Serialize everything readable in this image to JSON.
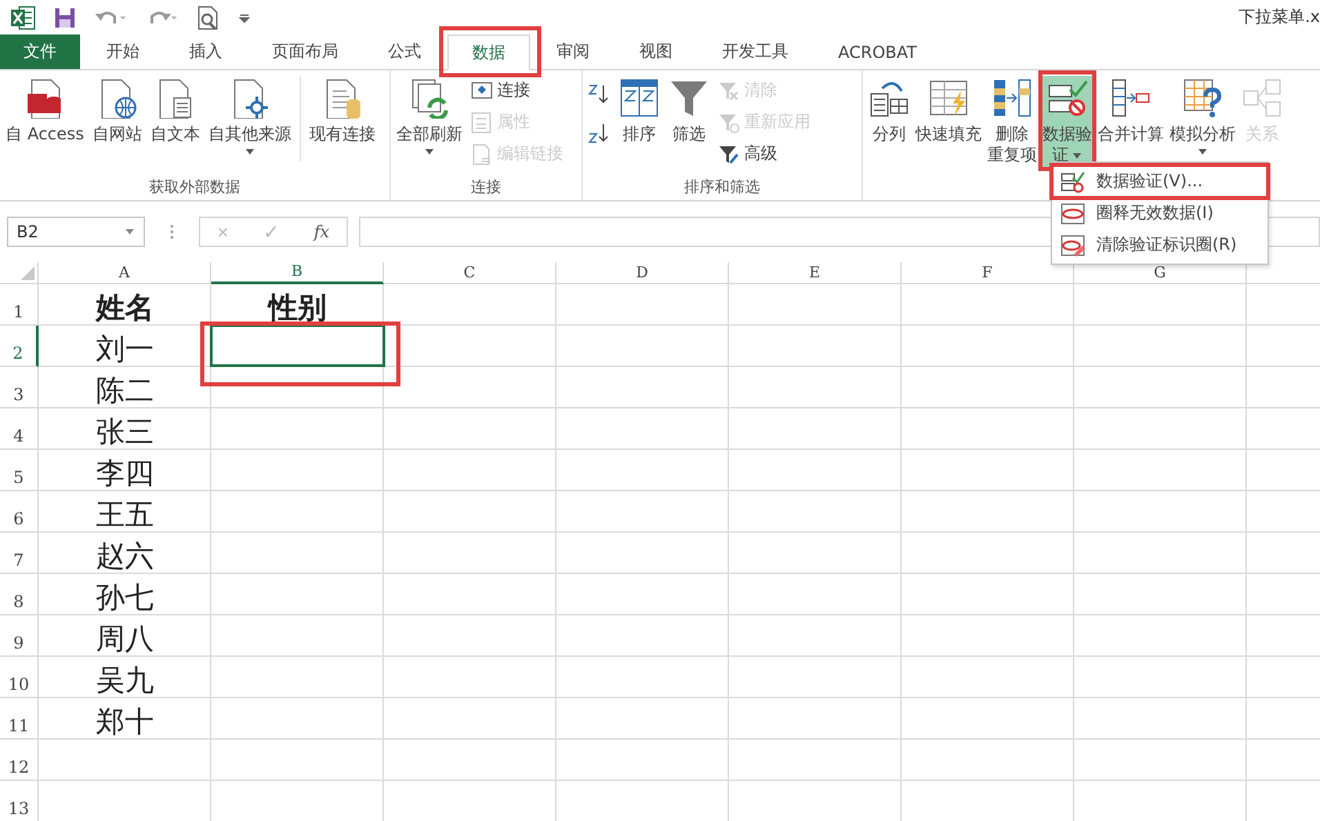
{
  "title": "下拉菜单.x",
  "tabs": [
    {
      "label": "文件",
      "kind": "file",
      "selected": false,
      "annotated": false
    },
    {
      "label": "开始",
      "kind": "tab",
      "selected": false,
      "annotated": false
    },
    {
      "label": "插入",
      "kind": "tab",
      "selected": false,
      "annotated": false
    },
    {
      "label": "页面布局",
      "kind": "tab",
      "selected": false,
      "annotated": false
    },
    {
      "label": "公式",
      "kind": "tab",
      "selected": false,
      "annotated": false
    },
    {
      "label": "数据",
      "kind": "tab",
      "selected": true,
      "annotated": true
    },
    {
      "label": "审阅",
      "kind": "tab",
      "selected": false,
      "annotated": false
    },
    {
      "label": "视图",
      "kind": "tab",
      "selected": false,
      "annotated": false
    },
    {
      "label": "开发工具",
      "kind": "tab",
      "selected": false,
      "annotated": false
    },
    {
      "label": "ACROBAT",
      "kind": "tab",
      "selected": false,
      "annotated": false
    }
  ],
  "ribbon": {
    "groups": [
      {
        "label": "获取外部数据",
        "buttons": [
          {
            "kind": "large",
            "lines": [
              "自 Access"
            ],
            "disabled": false,
            "dropdown": false
          },
          {
            "kind": "large",
            "lines": [
              "自网站"
            ],
            "disabled": false,
            "dropdown": false
          },
          {
            "kind": "large",
            "lines": [
              "自文本"
            ],
            "disabled": false,
            "dropdown": false
          },
          {
            "kind": "large",
            "lines": [
              "自其他来源"
            ],
            "disabled": false,
            "dropdown": true
          },
          {
            "kind": "large",
            "lines": [
              "现有连接"
            ],
            "disabled": false,
            "dropdown": false
          }
        ]
      },
      {
        "label": "连接",
        "buttons": [
          {
            "kind": "large",
            "lines": [
              "全部刷新"
            ],
            "disabled": false,
            "dropdown": true
          },
          {
            "kind": "small",
            "lines": [
              "连接"
            ],
            "disabled": false
          },
          {
            "kind": "small",
            "lines": [
              "属性"
            ],
            "disabled": true
          },
          {
            "kind": "small",
            "lines": [
              "编辑链接"
            ],
            "disabled": true
          }
        ]
      },
      {
        "label": "排序和筛选",
        "buttons": [
          {
            "kind": "icon"
          },
          {
            "kind": "icon"
          },
          {
            "kind": "large",
            "lines": [
              "排序"
            ],
            "disabled": false,
            "dropdown": false
          },
          {
            "kind": "large",
            "lines": [
              "筛选"
            ],
            "disabled": false,
            "dropdown": false
          },
          {
            "kind": "small",
            "lines": [
              "清除"
            ],
            "disabled": true
          },
          {
            "kind": "small",
            "lines": [
              "重新应用"
            ],
            "disabled": true
          },
          {
            "kind": "small",
            "lines": [
              "高级"
            ],
            "disabled": false
          }
        ]
      },
      {
        "buttons": [
          {
            "kind": "large",
            "lines": [
              "分列"
            ],
            "disabled": false,
            "dropdown": false
          },
          {
            "kind": "large",
            "lines": [
              "快速填充"
            ],
            "disabled": false,
            "dropdown": false
          },
          {
            "kind": "large",
            "lines": [
              "删除",
              "重复项"
            ],
            "disabled": false,
            "dropdown": false
          },
          {
            "kind": "large",
            "lines": [
              "数据验",
              "证"
            ],
            "disabled": false,
            "dropdown": true,
            "pressed": true,
            "annotated": true
          },
          {
            "kind": "large",
            "lines": [
              "合并计算"
            ],
            "disabled": false,
            "dropdown": false
          },
          {
            "kind": "large",
            "lines": [
              "模拟分析"
            ],
            "disabled": false,
            "dropdown": true
          },
          {
            "kind": "large",
            "lines": [
              "关系"
            ],
            "disabled": true,
            "dropdown": false
          }
        ]
      }
    ]
  },
  "menu": {
    "items": [
      {
        "label": "数据验证(V)...",
        "annotated": true
      },
      {
        "label": "圈释无效数据(I)",
        "annotated": false
      },
      {
        "label": "清除验证标识圈(R)",
        "annotated": false
      }
    ]
  },
  "formula_bar": {
    "name_box": "B2",
    "cancel": "×",
    "enter": "✓",
    "function": "fx"
  },
  "columns": [
    {
      "label": "A",
      "selected": false
    },
    {
      "label": "B",
      "selected": true
    },
    {
      "label": "C",
      "selected": false
    },
    {
      "label": "D",
      "selected": false
    },
    {
      "label": "E",
      "selected": false
    },
    {
      "label": "F",
      "selected": false
    },
    {
      "label": "G",
      "selected": false
    }
  ],
  "selection": {
    "annotated": true
  },
  "rows": [
    {
      "number": "1",
      "kind": "header",
      "selected": false,
      "cells": [
        "姓名",
        "性别"
      ]
    },
    {
      "number": "2",
      "kind": "data",
      "selected": true,
      "cells": [
        "刘一"
      ]
    },
    {
      "number": "3",
      "kind": "data",
      "selected": false,
      "cells": [
        "陈二"
      ]
    },
    {
      "number": "4",
      "kind": "data",
      "selected": false,
      "cells": [
        "张三"
      ]
    },
    {
      "number": "5",
      "kind": "data",
      "selected": false,
      "cells": [
        "李四"
      ]
    },
    {
      "number": "6",
      "kind": "data",
      "selected": false,
      "cells": [
        "王五"
      ]
    },
    {
      "number": "7",
      "kind": "data",
      "selected": false,
      "cells": [
        "赵六"
      ]
    },
    {
      "number": "8",
      "kind": "data",
      "selected": false,
      "cells": [
        "孙七"
      ]
    },
    {
      "number": "9",
      "kind": "data",
      "selected": false,
      "cells": [
        "周八"
      ]
    },
    {
      "number": "10",
      "kind": "data",
      "selected": false,
      "cells": [
        "吴九"
      ]
    },
    {
      "number": "11",
      "kind": "data",
      "selected": false,
      "cells": [
        "郑十"
      ]
    },
    {
      "number": "12",
      "kind": "data",
      "selected": false,
      "cells": []
    },
    {
      "number": "13",
      "kind": "data",
      "selected": false,
      "cells": []
    }
  ]
}
